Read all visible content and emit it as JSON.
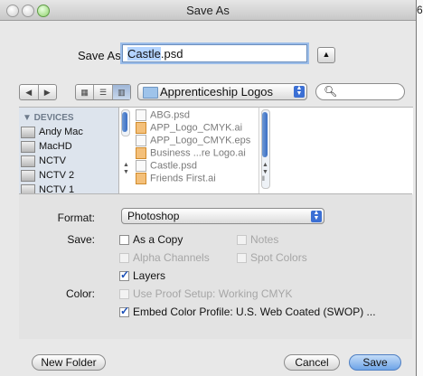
{
  "window": {
    "title": "Save As",
    "edge_title_fragment": "6"
  },
  "save_as": {
    "label": "Save As:",
    "filename_selected": "Castle",
    "filename_rest": ".psd"
  },
  "toolbar": {
    "location": "Apprenticeship Logos",
    "search_placeholder": ""
  },
  "sidebar": {
    "heading": "▼ DEVICES",
    "items": [
      "Andy Mac",
      "MacHD",
      "NCTV",
      "NCTV 2",
      "NCTV 1"
    ]
  },
  "files": [
    "ABG.psd",
    "APP_Logo_CMYK.ai",
    "APP_Logo_CMYK.eps",
    "Business ...re Logo.ai",
    "Castle.psd",
    "Friends First.ai"
  ],
  "options": {
    "format_label": "Format:",
    "format_value": "Photoshop",
    "save_label": "Save:",
    "as_a_copy": "As a Copy",
    "notes": "Notes",
    "alpha_channels": "Alpha Channels",
    "spot_colors": "Spot Colors",
    "layers": "Layers",
    "color_label": "Color:",
    "use_proof_setup": "Use Proof Setup:  Working CMYK",
    "embed_profile": "Embed Color Profile:  U.S. Web Coated (SWOP) ..."
  },
  "buttons": {
    "new_folder": "New Folder",
    "cancel": "Cancel",
    "save": "Save"
  }
}
